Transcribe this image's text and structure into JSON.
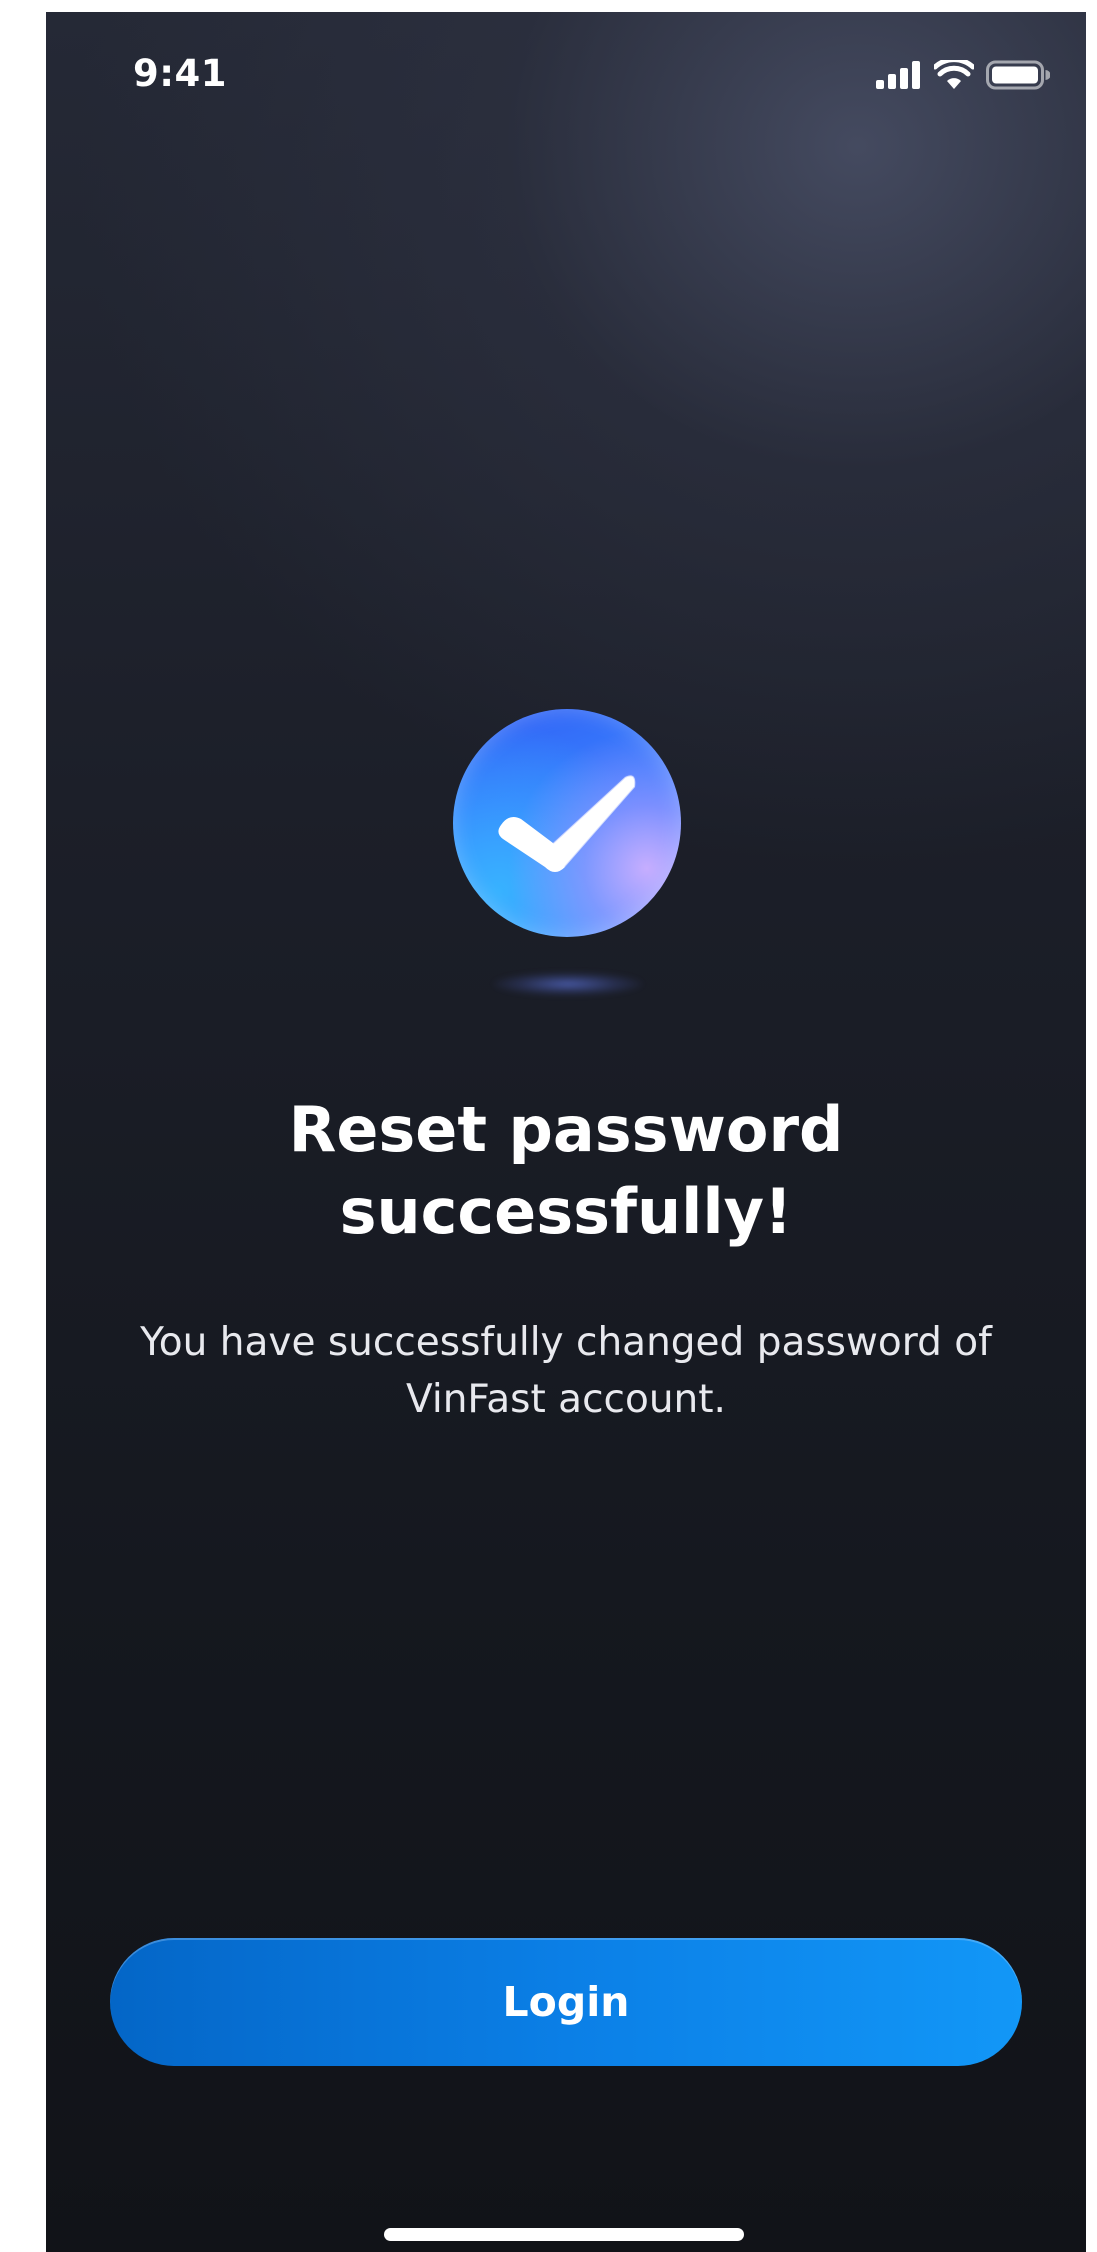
{
  "status_bar": {
    "time": "9:41",
    "icons": [
      "cellular-signal-icon",
      "wifi-icon",
      "battery-icon"
    ]
  },
  "hero": {
    "icon": "checkmark-icon",
    "icon_colors": [
      "#2f5ff4",
      "#37b2ff",
      "#cdafff"
    ]
  },
  "content": {
    "title_line1": "Reset password",
    "title_line2": "successfully!",
    "message_line1": "You have successfully changed password of",
    "message_line2": "VinFast account."
  },
  "actions": {
    "login_label": "Login"
  },
  "colors": {
    "background": "#1c1f29",
    "button": "#0b7fe6",
    "text": "#ffffff"
  }
}
